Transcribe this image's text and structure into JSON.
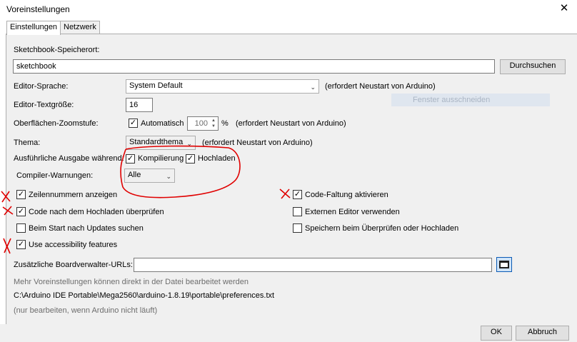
{
  "window": {
    "title": "Voreinstellungen",
    "close_icon": "close-icon"
  },
  "tabs": [
    {
      "label": "Einstellungen",
      "active": true
    },
    {
      "label": "Netzwerk",
      "active": false
    }
  ],
  "sketchbook": {
    "label": "Sketchbook-Speicherort:",
    "value": "sketchbook",
    "browse_label": "Durchsuchen"
  },
  "editor_language": {
    "label": "Editor-Sprache:",
    "selected": "System Default",
    "note": "(erfordert Neustart von Arduino)"
  },
  "ghost_overlay": {
    "text": "Fenster ausschneiden"
  },
  "editor_fontsize": {
    "label": "Editor-Textgröße:",
    "value": "16"
  },
  "zoom": {
    "label": "Oberflächen-Zoomstufe:",
    "auto_label": "Automatisch",
    "auto_checked": true,
    "value": "100",
    "unit": "%",
    "note": "(erfordert Neustart von Arduino)"
  },
  "theme": {
    "label": "Thema:",
    "selected": "Standardthema",
    "note": "(erfordert Neustart von Arduino)"
  },
  "verbose": {
    "label": "Ausführliche Ausgabe während:",
    "compile_label": "Kompilierung",
    "compile_checked": true,
    "upload_label": "Hochladen",
    "upload_checked": true
  },
  "compiler_warnings": {
    "label": "Compiler-Warnungen:",
    "selected": "Alle"
  },
  "options_left": [
    {
      "label": "Zeilennummern anzeigen",
      "checked": true
    },
    {
      "label": "Code nach dem Hochladen überprüfen",
      "checked": true
    },
    {
      "label": "Beim Start nach Updates suchen",
      "checked": false
    },
    {
      "label": "Use accessibility features",
      "checked": true
    }
  ],
  "options_right": [
    {
      "label": "Code-Faltung aktivieren",
      "checked": true
    },
    {
      "label": "Externen Editor verwenden",
      "checked": false
    },
    {
      "label": "Speichern beim Überprüfen oder Hochladen",
      "checked": false
    }
  ],
  "board_urls": {
    "label": "Zusätzliche Boardverwalter-URLs:",
    "value": "",
    "icon": "window-icon"
  },
  "more_prefs": {
    "hint": "Mehr Voreinstellungen können direkt in der Datei bearbeitet werden",
    "path": "C:\\Arduino IDE Portable\\Mega2560\\arduino-1.8.19\\portable\\preferences.txt",
    "note": "(nur bearbeiten, wenn Arduino nicht läuft)"
  },
  "footer": {
    "ok_label": "OK",
    "cancel_label": "Abbruch"
  },
  "colors": {
    "annotation_red": "#e00000",
    "dialog_bg": "#f0f0f0",
    "ghost_bg": "#dfe6ef"
  }
}
